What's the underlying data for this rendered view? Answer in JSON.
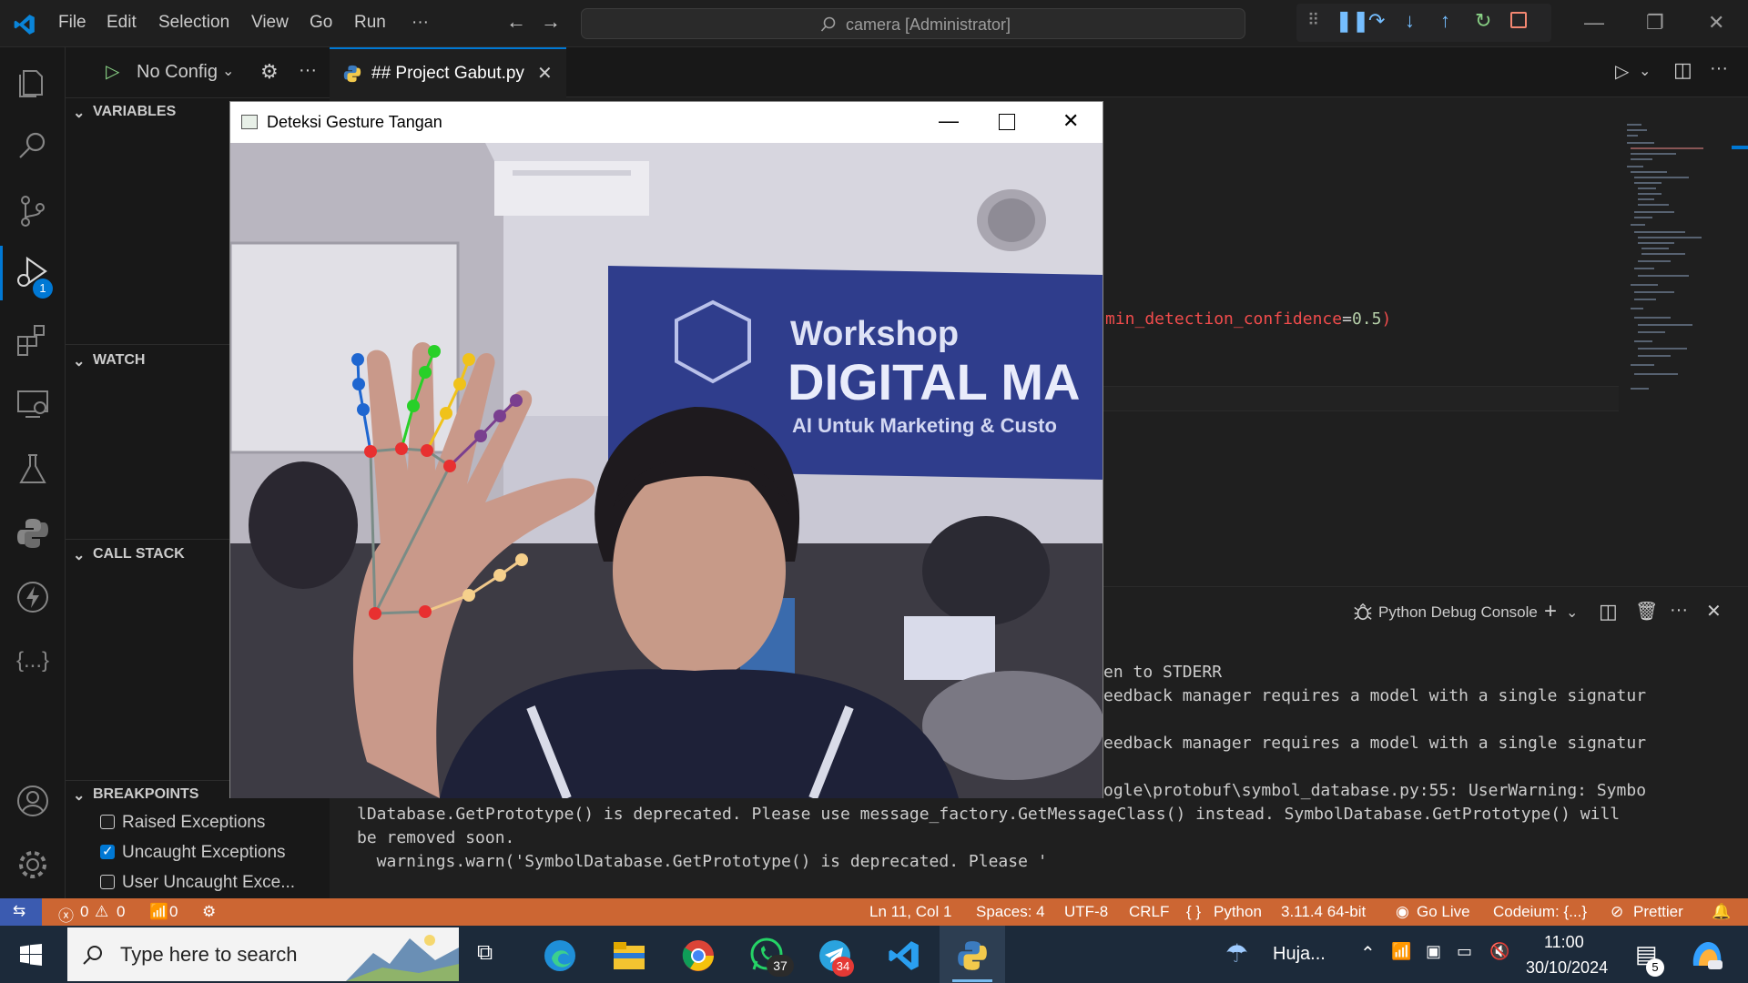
{
  "titlebar": {
    "menu": [
      "File",
      "Edit",
      "Selection",
      "View",
      "Go",
      "Run",
      "···"
    ],
    "search_text": "camera [Administrator]"
  },
  "activity": {
    "debug_badge": "1"
  },
  "sidebar": {
    "run_config": "No Configu",
    "variables_label": "VARIABLES",
    "watch_label": "WATCH",
    "callstack_label": "CALL STACK",
    "breakpoints_label": "BREAKPOINTS",
    "breakpoints": [
      {
        "label": "Raised Exceptions",
        "checked": false
      },
      {
        "label": "Uncaught Exceptions",
        "checked": true
      },
      {
        "label": "User Uncaught Exce...",
        "checked": false
      }
    ]
  },
  "editor": {
    "tab_label": "## Project Gabut.py",
    "code_fragment_name": "min_detection_confidence",
    "code_fragment_eq": "=",
    "code_fragment_val": "0.5",
    "code_fragment_paren": ")"
  },
  "panel": {
    "console_title": "Python Debug Console",
    "lines": [
      "en to STDERR",
      "eedback manager requires a model with a single signatur",
      "eedback manager requires a model with a single signatur",
      "ogle\\protobuf\\symbol_database.py:55: UserWarning: Symbo",
      "lDatabase.GetPrototype() is deprecated. Please use message_factory.GetMessageClass() instead. SymbolDatabase.GetPrototype() will",
      "be removed soon.",
      "  warnings.warn('SymbolDatabase.GetPrototype() is deprecated. Please '"
    ]
  },
  "statusbar": {
    "errors": "0",
    "warnings": "0",
    "ports": "0",
    "position": "Ln 11, Col 1",
    "spaces": "Spaces: 4",
    "encoding": "UTF-8",
    "eol": "CRLF",
    "language": "Python",
    "interpreter": "3.11.4 64-bit",
    "golive": "Go Live",
    "codeium": "Codeium: {...}",
    "prettier": "Prettier"
  },
  "taskbar": {
    "search_placeholder": "Type here to search",
    "whatsapp_badge": "37",
    "telegram_badge": "34",
    "weather": "Huja...",
    "time": "11:00",
    "date": "30/10/2024",
    "notif_badge": "5"
  },
  "camera_window": {
    "title": "Deteksi Gesture Tangan",
    "banner_line1": "Workshop",
    "banner_line2": "DIGITAL MA",
    "banner_line3": "AI Untuk Marketing & Custo"
  },
  "colors": {
    "status_bar": "#cc6633",
    "accent": "#0078d4",
    "code_red": "#f14c4c"
  }
}
